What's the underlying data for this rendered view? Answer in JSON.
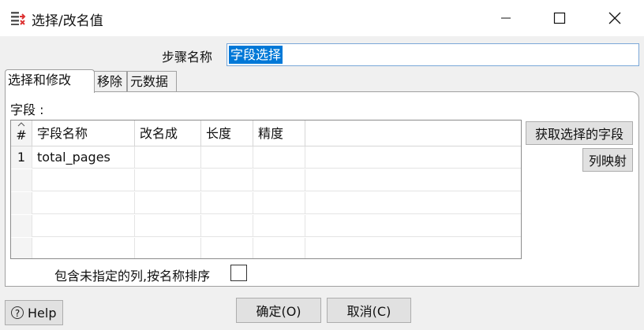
{
  "window": {
    "title": "选择/改名值",
    "icons": {
      "app": "select-values-icon",
      "minimize": "minimize-icon",
      "maximize": "maximize-icon",
      "close": "close-icon"
    }
  },
  "step": {
    "label": "步骤名称",
    "value": "字段选择"
  },
  "tabs": [
    {
      "label": "选择和修改",
      "active": true
    },
    {
      "label": "移除",
      "active": false
    },
    {
      "label": "元数据",
      "active": false
    }
  ],
  "fields": {
    "label": "字段 :",
    "columns": [
      "#",
      "字段名称",
      "改名成",
      "长度",
      "精度"
    ],
    "rows": [
      {
        "num": "1",
        "name": "total_pages",
        "rename": "",
        "length": "",
        "precision": ""
      }
    ],
    "get_fields_button": "获取选择的字段",
    "column_map_button": "列映射"
  },
  "include_unspecified": {
    "label": "包含未指定的列,按名称排序",
    "checked": false
  },
  "buttons": {
    "help": "Help",
    "ok": "确定(O)",
    "cancel": "取消(C)"
  },
  "colors": {
    "selection": "#0078d7",
    "input_border": "#7aa7d8",
    "dialog_bg": "#f0f0f0"
  }
}
